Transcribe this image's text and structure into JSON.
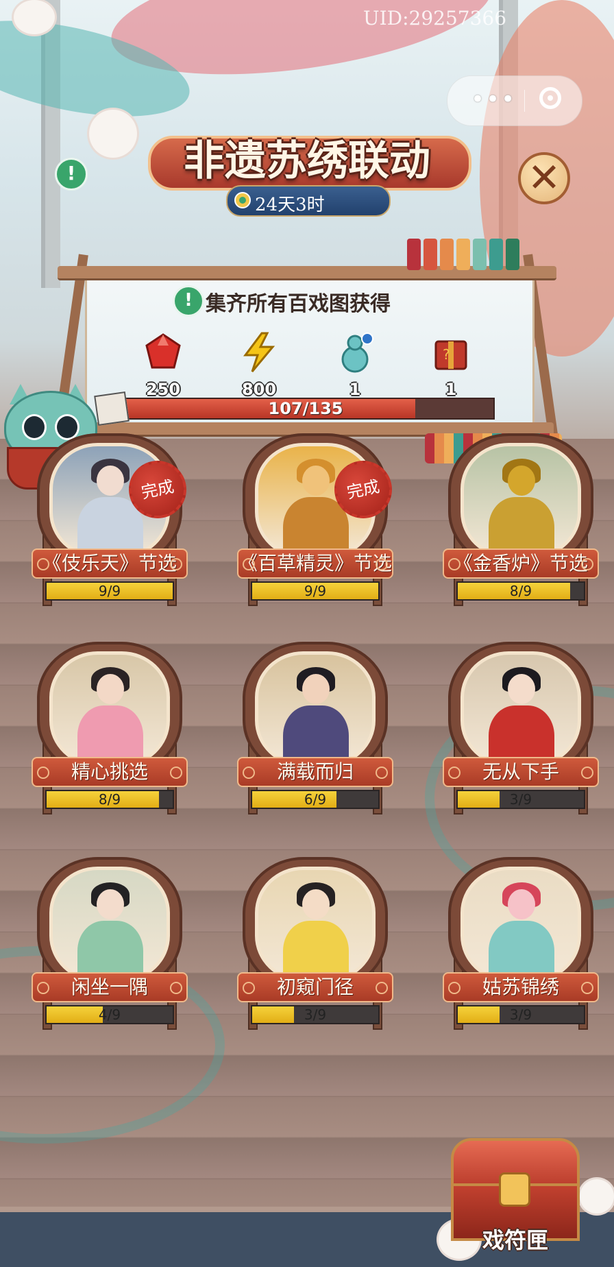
{
  "header": {
    "uid": "UID:29257366",
    "title": "非遗苏绣联动",
    "timer": "24天3时"
  },
  "goal": {
    "text": "集齐所有百戏图获得",
    "rewards": [
      {
        "name": "red-gem",
        "count": "250",
        "color": "#d9302a"
      },
      {
        "name": "lightning",
        "count": "800",
        "color": "#f5c518"
      },
      {
        "name": "gourd",
        "count": "1",
        "color": "#6cc3c4"
      },
      {
        "name": "mystery-box",
        "count": "1",
        "color": "#c0392b"
      }
    ],
    "progress_text": "107/135",
    "progress_value": 107,
    "progress_max": 135
  },
  "cards": [
    {
      "label": "《伎乐天》节选",
      "progress": "9/9",
      "done": 9,
      "total": 9,
      "completed": true,
      "done_label": "完成",
      "scene": "#8da2b8",
      "skin": "#f1dcd0",
      "hair": "#3a3440",
      "robe": "#c9d3e0"
    },
    {
      "label": "《百草精灵》节选",
      "progress": "9/9",
      "done": 9,
      "total": 9,
      "completed": true,
      "done_label": "完成",
      "scene": "#e9b34a",
      "skin": "#f0c27a",
      "hair": "#d48f2e",
      "robe": "#c98430"
    },
    {
      "label": "《金香炉》节选",
      "progress": "8/9",
      "done": 8,
      "total": 9,
      "completed": false,
      "scene": "#b7c3a5",
      "skin": "#d4a62c",
      "hair": "#a27614",
      "robe": "#caa032"
    },
    {
      "label": "精心挑选",
      "progress": "8/9",
      "done": 8,
      "total": 9,
      "completed": false,
      "scene": "#d8c7a8",
      "skin": "#f3d8c6",
      "hair": "#2a2324",
      "robe": "#ef9bb0"
    },
    {
      "label": "满载而归",
      "progress": "6/9",
      "done": 6,
      "total": 9,
      "completed": false,
      "scene": "#d8c39e",
      "skin": "#f1d2bb",
      "hair": "#1f1c22",
      "robe": "#4f4a7c"
    },
    {
      "label": "无从下手",
      "progress": "3/9",
      "done": 3,
      "total": 9,
      "completed": false,
      "scene": "#d7c7ae",
      "skin": "#f4dccb",
      "hair": "#1c1a1f",
      "robe": "#c9312c"
    },
    {
      "label": "闲坐一隅",
      "progress": "4/9",
      "done": 4,
      "total": 9,
      "completed": false,
      "scene": "#d6d8c4",
      "skin": "#f3dccc",
      "hair": "#232224",
      "robe": "#8fc7a8"
    },
    {
      "label": "初窥门径",
      "progress": "3/9",
      "done": 3,
      "total": 9,
      "completed": false,
      "scene": "#e8d6b2",
      "skin": "#f4dcc6",
      "hair": "#262223",
      "robe": "#f0d04a"
    },
    {
      "label": "姑苏锦绣",
      "progress": "3/9",
      "done": 3,
      "total": 9,
      "completed": false,
      "scene": "#eadcc4",
      "skin": "#f6c2c8",
      "hair": "#d6455a",
      "robe": "#82c9c3"
    }
  ],
  "chest": {
    "label": "戏符匣"
  }
}
